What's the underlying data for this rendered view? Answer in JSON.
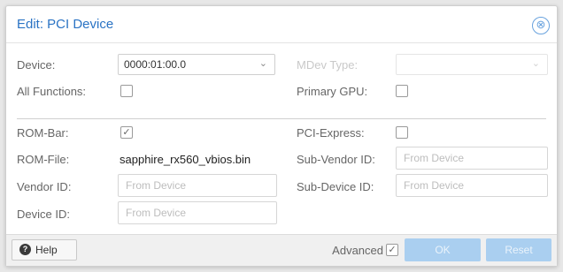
{
  "dialog": {
    "title": "Edit: PCI Device",
    "close_icon": "⊗"
  },
  "fields": {
    "device": {
      "label": "Device:",
      "value": "0000:01:00.0"
    },
    "mdev_type": {
      "label": "MDev Type:",
      "value": ""
    },
    "all_functions": {
      "label": "All Functions:",
      "checked": false
    },
    "primary_gpu": {
      "label": "Primary GPU:",
      "checked": false
    },
    "rom_bar": {
      "label": "ROM-Bar:",
      "checked": true
    },
    "pci_express": {
      "label": "PCI-Express:",
      "checked": false
    },
    "rom_file": {
      "label": "ROM-File:",
      "value": "sapphire_rx560_vbios.bin"
    },
    "sub_vendor_id": {
      "label": "Sub-Vendor ID:",
      "placeholder": "From Device"
    },
    "vendor_id": {
      "label": "Vendor ID:",
      "placeholder": "From Device"
    },
    "sub_device_id": {
      "label": "Sub-Device ID:",
      "placeholder": "From Device"
    },
    "device_id": {
      "label": "Device ID:",
      "placeholder": "From Device"
    }
  },
  "footer": {
    "help_label": "Help",
    "advanced_label": "Advanced",
    "advanced_checked": true,
    "ok_label": "OK",
    "reset_label": "Reset"
  },
  "colors": {
    "title": "#2a73c4",
    "primary_button": "#aacff0",
    "divider": "#cfcfcf"
  },
  "icons": {
    "close": "close-icon",
    "help": "help-icon",
    "dropdown": "chevron-down-icon",
    "checkbox": "checkbox-icon"
  }
}
